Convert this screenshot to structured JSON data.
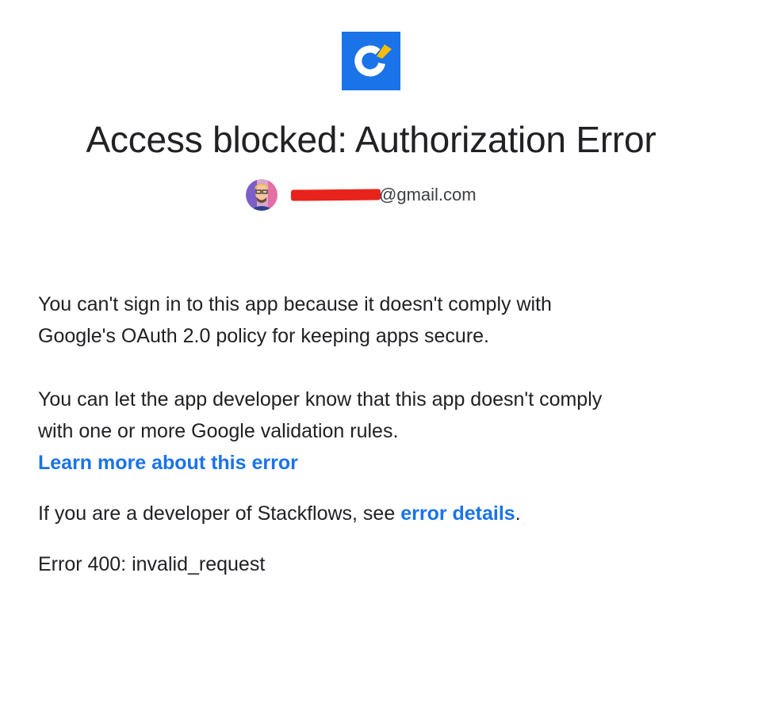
{
  "app": {
    "logo_icon": "stackflows-logo-icon",
    "logo_bg_color": "#1a73e8",
    "logo_accent_color": "#fbbc04"
  },
  "page": {
    "title": "Access blocked: Authorization Error"
  },
  "account": {
    "avatar_icon": "user-avatar",
    "email_local_redacted": "xxxxxxxxxx",
    "email_domain": "@gmail.com"
  },
  "message": {
    "line1": "You can't sign in to this app because it doesn't comply with",
    "line2": "Google's OAuth 2.0 policy for keeping apps secure.",
    "line3": "You can let the app developer know that this app doesn't comply",
    "line4": "with one or more Google validation rules.",
    "learn_more_link": "Learn more about this error",
    "developer_prefix": "If you are a developer of Stackflows, see ",
    "error_details_link": "error details",
    "developer_suffix": ".",
    "error_code": "Error 400: invalid_request"
  },
  "colors": {
    "link": "#1a73e8",
    "text": "#202124",
    "redaction": "#e8231c"
  }
}
